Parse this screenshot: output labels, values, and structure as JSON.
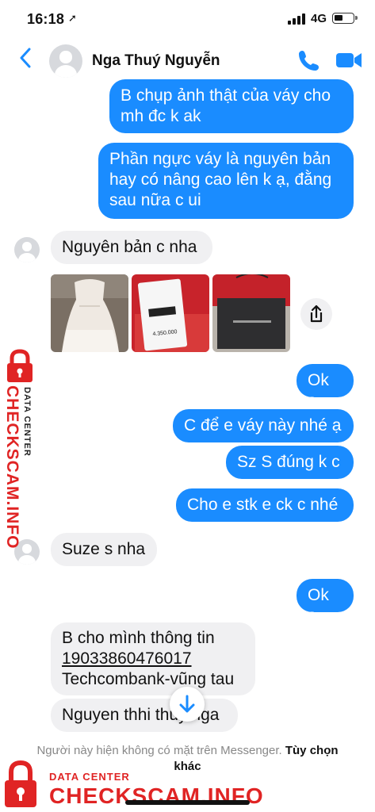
{
  "status_bar": {
    "time": "16:18",
    "location_icon": "location-arrow-icon",
    "network": "4G"
  },
  "header": {
    "back_icon": "chevron-left-icon",
    "contact_name": "Nga Thuý Nguyễn",
    "call_icon": "phone-icon",
    "video_icon": "video-camera-icon"
  },
  "messages": [
    {
      "side": "out",
      "text": "B chụp ảnh thật của váy cho\nmh đc k ak"
    },
    {
      "side": "out",
      "text": "Phần ngực váy là nguyên bản\nhay có nâng cao lên k ạ, đằng\nsau nữa c ui"
    },
    {
      "side": "in",
      "text": "Nguyên bản c nha"
    },
    {
      "side": "in",
      "type": "photos",
      "photos": [
        "dress-photo",
        "price-tag-photo",
        "gift-bag-photo"
      ]
    },
    {
      "side": "out",
      "text": "Ok ạ"
    },
    {
      "side": "out",
      "text": "C để e váy này nhé ạ"
    },
    {
      "side": "out",
      "text": "Sz S đúng k c"
    },
    {
      "side": "out",
      "text": "Cho e stk e ck c nhé"
    },
    {
      "side": "in",
      "text": "Suze s nha"
    },
    {
      "side": "out",
      "text": "Ok ạ"
    },
    {
      "side": "in",
      "lines": [
        "B cho mình thông tin",
        "19033860476017",
        "Techcombank-vũng tau"
      ]
    },
    {
      "side": "in",
      "text": "Nguyen thhi thuy nga"
    }
  ],
  "photo_tag_text": "4.350.000",
  "share_icon": "share-icon",
  "scroll_down_icon": "arrow-down-icon",
  "footer": {
    "note": "Người này hiện không có mặt trên Messenger.",
    "option": "Tùy chọn khác"
  },
  "watermark": {
    "brand": "CHECKSCAM.INFO",
    "sub": "DATA CENTER"
  },
  "colors": {
    "accent": "#1a8cff",
    "incoming_bubble": "#f0f0f2",
    "watermark": "#e02424"
  }
}
